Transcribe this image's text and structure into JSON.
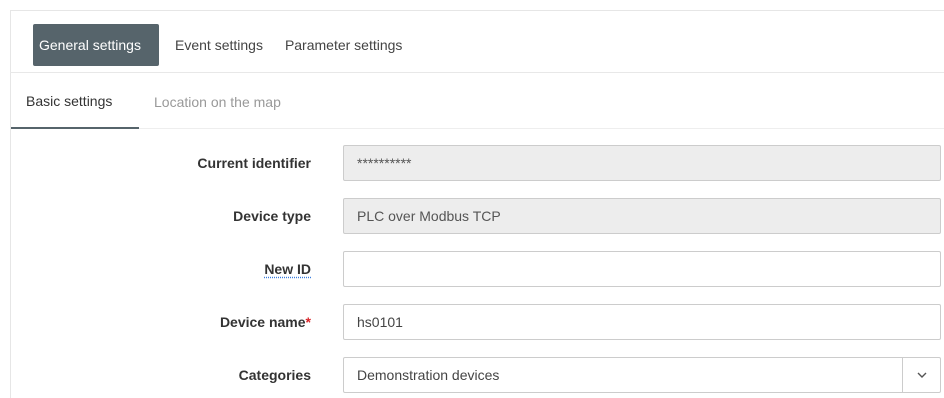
{
  "tabs": {
    "primary": [
      {
        "label": "General settings",
        "active": true
      },
      {
        "label": "Event settings",
        "active": false
      },
      {
        "label": "Parameter settings",
        "active": false
      }
    ],
    "secondary": [
      {
        "label": "Basic settings",
        "active": true
      },
      {
        "label": "Location on the map",
        "active": false
      }
    ]
  },
  "form": {
    "current_identifier": {
      "label": "Current identifier",
      "value": "**********"
    },
    "device_type": {
      "label": "Device type",
      "value": "PLC over Modbus TCP"
    },
    "new_id": {
      "label": "New ID",
      "value": ""
    },
    "device_name": {
      "label": "Device name",
      "required_mark": "*",
      "value": "hs0101"
    },
    "categories": {
      "label": "Categories",
      "selected": "Demonstration devices"
    }
  },
  "icons": {
    "select_arrow": "chevron-down-icon"
  },
  "colors": {
    "active_tab_bg": "#56646b",
    "required": "#d9262a",
    "readonly_bg": "#ededed"
  }
}
